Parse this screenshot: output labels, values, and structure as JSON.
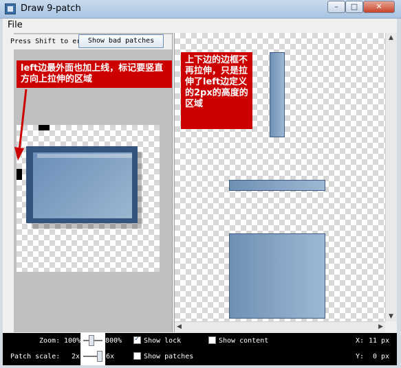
{
  "window": {
    "title": "Draw 9-patch",
    "minimize_label": "–",
    "maximize_label": "□",
    "close_label": "✕"
  },
  "menu": {
    "file_label": "File"
  },
  "toolbar": {
    "hint_text": "Press Shift to er",
    "bad_patches_label": "Show bad patches"
  },
  "annotations": {
    "left_note": "left边最外面也加上线，标记要竖直方向上拉伸的区域",
    "right_note": "上下边的边框不再拉伸，只是拉伸了left边定义的2px的高度的区域"
  },
  "status": {
    "zoom_label": "Zoom:",
    "zoom_min": "100%",
    "zoom_max": "800%",
    "scale_label": "Patch scale:",
    "scale_min": "2x",
    "scale_max": "6x",
    "show_lock_label": "Show lock",
    "show_lock_checked": true,
    "show_content_label": "Show content",
    "show_content_checked": false,
    "show_patches_label": "Show patches",
    "show_patches_checked": false,
    "x_label": "X:",
    "x_value": "11 px",
    "y_label": "Y:",
    "y_value": "0 px"
  },
  "colors": {
    "annotation_red": "#cc0000",
    "patch_blue": "#34547d"
  }
}
